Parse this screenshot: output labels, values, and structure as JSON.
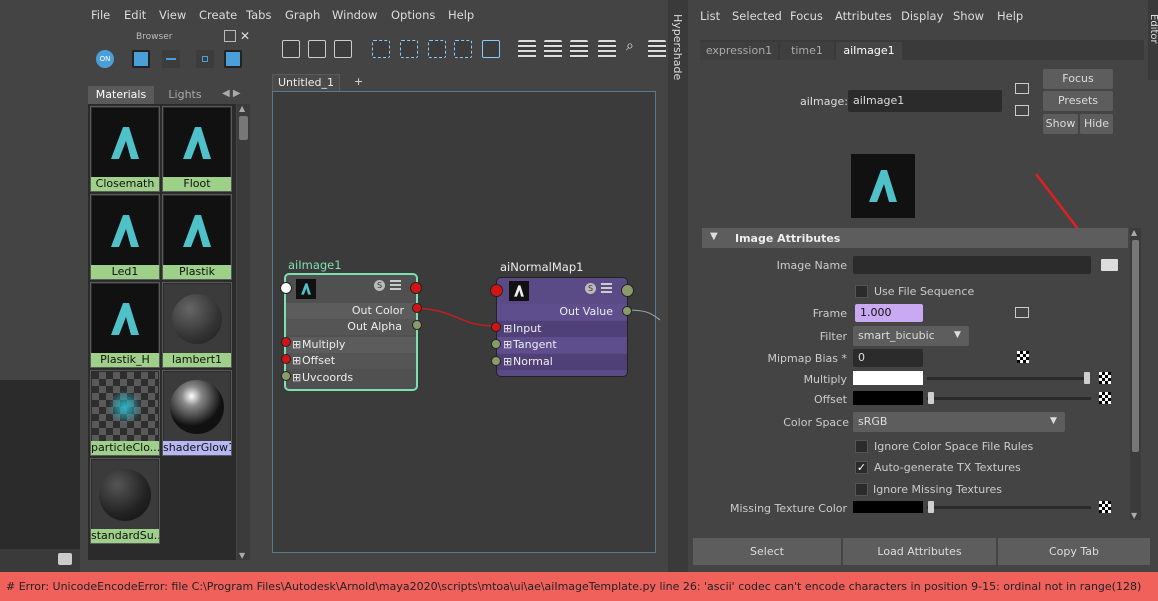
{
  "hypershade": {
    "menu": [
      "File",
      "Edit",
      "View",
      "Create",
      "Tabs",
      "Graph",
      "Window",
      "Options",
      "Help"
    ],
    "browser_label": "Browser",
    "browser_tabs": [
      "Materials",
      "Lights"
    ],
    "materials": [
      "Closemath",
      "Floot",
      "Led1",
      "Plastik",
      "Plastik_H",
      "lambert1",
      "particleClo...",
      "shaderGlow1",
      "standardSu..."
    ],
    "graph_tab": "Untitled_1",
    "graph_tab_add": "+",
    "side_label": "Hypershade",
    "node_ailmage": {
      "title": "aiImage1",
      "outputs": [
        "Out Color",
        "Out Alpha"
      ],
      "inputs": [
        "Multiply",
        "Offset",
        "Uvcoords"
      ]
    },
    "node_normalmap": {
      "title": "aiNormalMap1",
      "outputs": [
        "Out Value"
      ],
      "inputs": [
        "Input",
        "Tangent",
        "Normal"
      ]
    },
    "node_badge": "S"
  },
  "attribute_editor": {
    "menu": [
      "List",
      "Selected",
      "Focus",
      "Attributes",
      "Display",
      "Show",
      "Help"
    ],
    "tabs": [
      "expression1",
      "time1",
      "aiImage1"
    ],
    "node_label": "aiImage:",
    "node_value": "aiImage1",
    "focus": "Focus",
    "presets": "Presets",
    "show": "Show",
    "hide": "Hide",
    "section": "Image Attributes",
    "image_name_label": "Image Name",
    "image_name_value": "",
    "use_file_sequence": "Use File Sequence",
    "frame_label": "Frame",
    "frame_value": "1.000",
    "filter_label": "Filter",
    "filter_value": "smart_bicubic",
    "mipmap_label": "Mipmap Bias *",
    "mipmap_value": "0",
    "multiply_label": "Multiply",
    "offset_label": "Offset",
    "colorspace_label": "Color Space",
    "colorspace_value": "sRGB",
    "ignore_cs": "Ignore Color Space File Rules",
    "autogen_tx": "Auto-generate TX Textures",
    "ignore_missing": "Ignore Missing Textures",
    "missing_color_label": "Missing Texture Color",
    "select_btn": "Select",
    "load_btn": "Load Attributes",
    "copy_btn": "Copy Tab",
    "side_label": "Attribute Editor"
  },
  "error_text": "# Error: UnicodeEncodeError: file C:\\Program Files\\Autodesk\\Arnold\\maya2020\\scripts\\mtoa\\ui\\ae\\aiImageTemplate.py line 26: 'ascii' codec can't encode characters in position 9-15: ordinal not in range(128)",
  "colors": {
    "error_bg": "#f0615c",
    "swatch_label": "#9ed08a",
    "frame_field": "#c9a9f2",
    "ailmage_outline": "#7de0b0",
    "normalmap_body": "#5a4a86",
    "annotation_arrow": "#e02020"
  }
}
